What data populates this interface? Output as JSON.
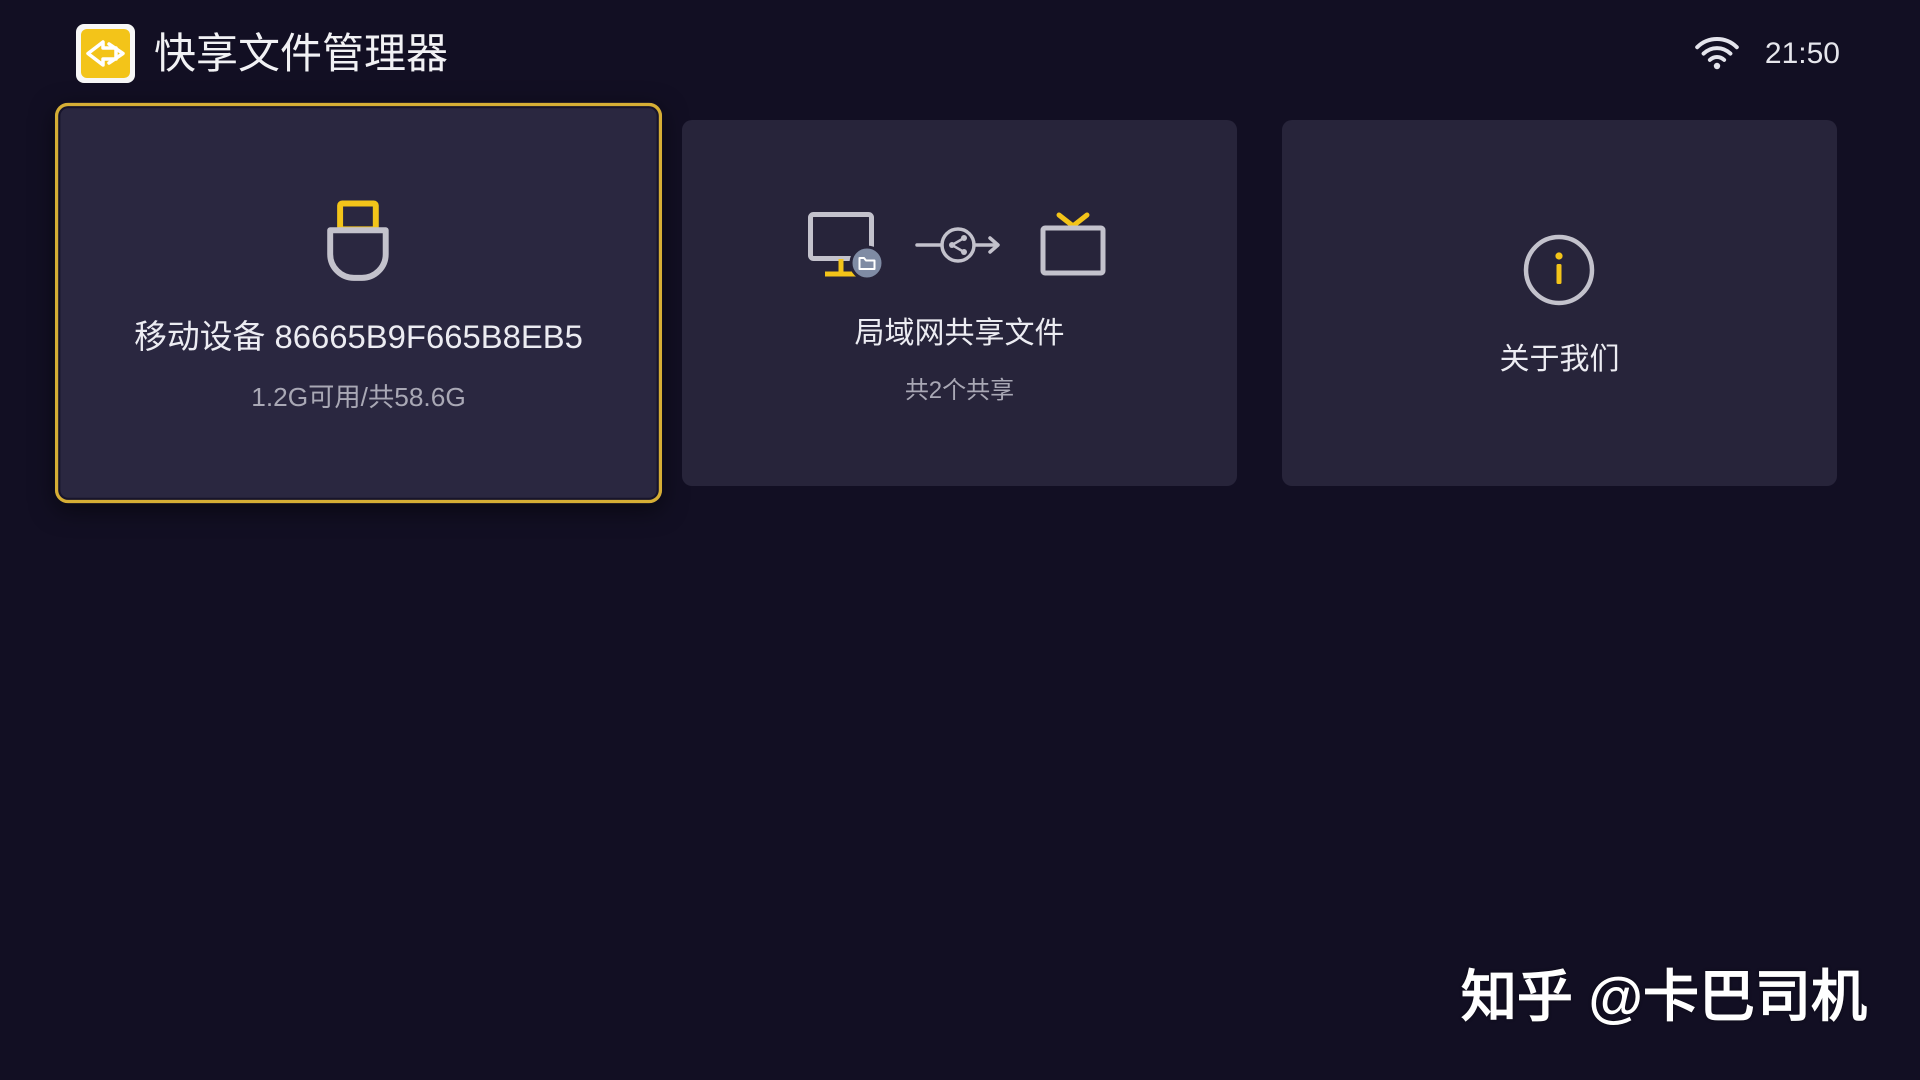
{
  "header": {
    "app_title": "快享文件管理器",
    "time": "21:50",
    "logo_icon": "app-logo-icon",
    "status_icons": [
      "wifi-icon"
    ]
  },
  "cards": [
    {
      "title": "移动设备 86665B9F665B8EB5",
      "subtitle": "1.2G可用/共58.6G",
      "icon": "usb-drive-icon",
      "focused": true
    },
    {
      "title": "局域网共享文件",
      "subtitle": "共2个共享",
      "icons": [
        "computer-folder-icon",
        "share-transfer-icon",
        "tv-icon"
      ],
      "focused": false
    },
    {
      "title": "关于我们",
      "icon": "info-icon",
      "focused": false
    }
  ],
  "watermark": "知乎 @卡巴司机",
  "colors": {
    "background": "#120f23",
    "card": "#27243a",
    "focus_border": "#d6ae35",
    "accent": "#f3c419",
    "icon_grey": "#c3c2cc",
    "text": "#ececf2",
    "subtext": "#a9a8b5"
  }
}
